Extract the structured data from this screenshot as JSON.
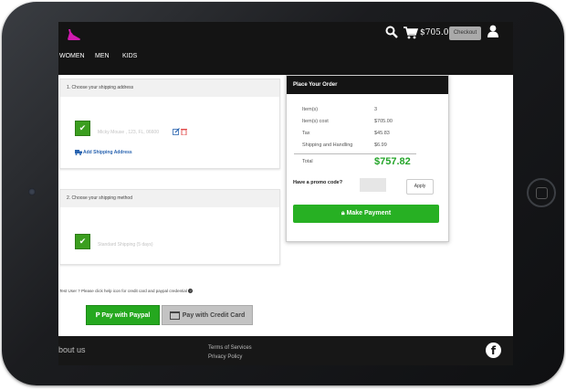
{
  "header": {
    "cart_total": "$705.00",
    "checkout_label": "Checkout",
    "nav": [
      "WOMEN",
      "MEN",
      "KIDS"
    ]
  },
  "shipping_address": {
    "title": "1. Choose your shipping address",
    "address": "Micky Mouse , 123, FL, 06600",
    "add_label": "Add Shipping Address"
  },
  "shipping_method": {
    "title": "2. Choose your shipping method",
    "method": "Standard Shipping (5 days)"
  },
  "order": {
    "title": "Place Your Order",
    "rows": [
      {
        "label": "Item(s)",
        "value": "3"
      },
      {
        "label": "Item(s) cost",
        "value": "$705.00"
      },
      {
        "label": "Tax",
        "value": "$45.83"
      },
      {
        "label": "Shipping and Handling",
        "value": "$6.99"
      }
    ],
    "total_label": "Total",
    "total_value": "$757.82",
    "promo_label": "Have a promo code?",
    "apply_label": "Apply",
    "pay_label": "Make Payment"
  },
  "payment": {
    "note": "Test User ? Please click help icon for credit card and paypal credential",
    "paypal_label": "Pay with Paypal",
    "card_label": "Pay with Credit Card"
  },
  "footer": {
    "about": "bout us",
    "terms": "Terms of Services",
    "privacy": "Privacy Policy"
  },
  "colors": {
    "accent_green": "#27b023",
    "total_green": "#25a52a",
    "header_bg": "#141414"
  },
  "icons": [
    "shoe-logo-icon",
    "search-icon",
    "cart-icon",
    "user-icon",
    "checkmark-icon",
    "edit-icon",
    "trash-icon",
    "truck-icon",
    "lock-icon",
    "paypal-icon",
    "credit-card-icon",
    "help-icon",
    "facebook-icon"
  ]
}
